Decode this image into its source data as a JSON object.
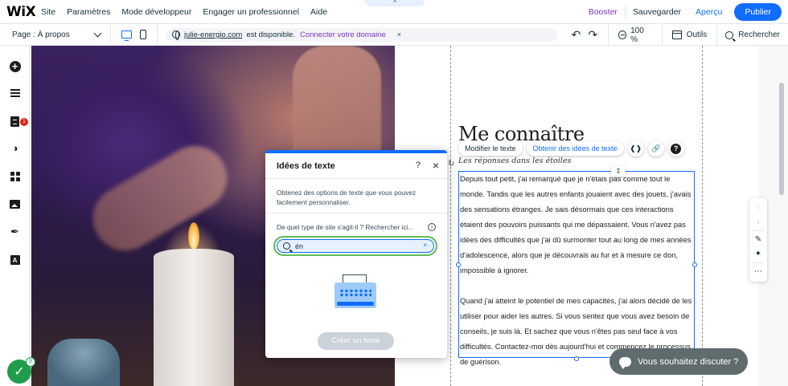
{
  "topbar": {
    "logo": "WiX",
    "menu": [
      "Site",
      "Paramètres",
      "Mode développeur",
      "Engager un professionnel",
      "Aide"
    ],
    "collapse_icon": "^",
    "boost": "Booster",
    "save": "Sauvegarder",
    "preview": "Aperçu",
    "publish": "Publier"
  },
  "secondbar": {
    "page_label": "Page : À propos",
    "domain": "julie-energio.com",
    "domain_status": "est disponible.",
    "connect": "Connecter votre domaine",
    "close": "×",
    "undo": "↶",
    "redo": "↷",
    "zoom": "100 %",
    "tools": "Outils",
    "search": "Rechercher"
  },
  "leftbar": {
    "apps_badge": "1"
  },
  "content": {
    "heading": "Me connaître",
    "subheading": "Les réponses dans les étoiles",
    "paragraphs": [
      "Depuis tout petit, j'ai remarqué que je n'étais pas comme tout le monde. Tandis que les autres enfants jouaient avec des jouets, j'avais des sensations étranges. Je sais désormais que ces interactions étaient des pouvoirs puissants qui me dépassaient. Vous n'avez pas idées des difficultés que j'ai dû surmonter tout au long de mes années d'adolescence, alors que je découvrais au fur et à mesure ce don, impossible à ignorer.",
      "Quand j'ai atteint le potentiel de mes capacités, j'ai alors décidé de les utiliser pour aider les autres. Si vous sentez que vous avez besoin de conseils, je suis là. Et sachez que vous n'êtes pas seul face à vos difficultés. Contactez-moi dès aujourd'hui et commencez le processus de guérison."
    ]
  },
  "text_toolbar": {
    "edit_text": "Modifier le texte",
    "get_ideas": "Obtenir des idées de texte",
    "help": "?"
  },
  "panel": {
    "title": "Idées de texte",
    "help": "?",
    "close": "×",
    "description": "Obtenez des options de texte que vous pouvez facilement personnaliser.",
    "question": "De quel type de site s'agit-il ? Rechercher ici...",
    "info": "i",
    "search_value": "én",
    "clear": "×",
    "create_button": "Créer un texte"
  },
  "chat": {
    "label": "Vous souhaitez discuter ?"
  },
  "checklist": {
    "badge": "9"
  },
  "colors": {
    "accent": "#116dff",
    "boost": "#8034c9",
    "focus": "#60bc57"
  }
}
